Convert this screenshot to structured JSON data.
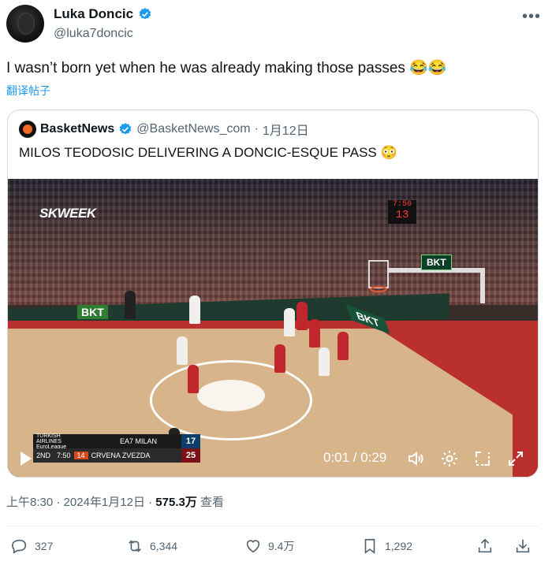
{
  "author": {
    "name": "Luka Doncic",
    "handle": "@luka7doncic"
  },
  "tweet": {
    "text": "I wasn’t born yet when he was already making those passes 😂😂",
    "translate_label": "翻译帖子"
  },
  "quote": {
    "name": "BasketNews",
    "handle": "@BasketNews_com",
    "separator": "·",
    "date": "1月12日",
    "text": "MILOS TEODOSIC DELIVERING A DONCIC-ESQUE PASS 😳"
  },
  "video": {
    "watermark": "SKWEEK",
    "shot_clock_top": "7:50",
    "shot_clock_bottom": "13",
    "court_ad": "BKT",
    "board_ad": "BKT",
    "time_display": "0:01 / 0:29",
    "scorebug": {
      "league": "TURKISH AIRLINES EuroLeague",
      "period": "2ND",
      "clock": "7:50",
      "shot": "14",
      "team1": "EA7 MILAN",
      "score1": "17",
      "team2": "CRVENA ZVEZDA",
      "score2": "25"
    },
    "icons": [
      "play-icon",
      "volume-icon",
      "settings-icon",
      "minimize-icon",
      "fullscreen-icon"
    ]
  },
  "meta": {
    "time": "上午8:30",
    "separator": "·",
    "date": "2024年1月12日",
    "separator2": "·",
    "views": "575.3万",
    "views_label": "查看"
  },
  "actions": {
    "replies": "327",
    "retweets": "6,344",
    "likes": "9.4万",
    "bookmarks": "1,292"
  },
  "colors": {
    "link": "#1d9bf0",
    "secondary": "#536471",
    "verified": "#1d9bf0"
  }
}
